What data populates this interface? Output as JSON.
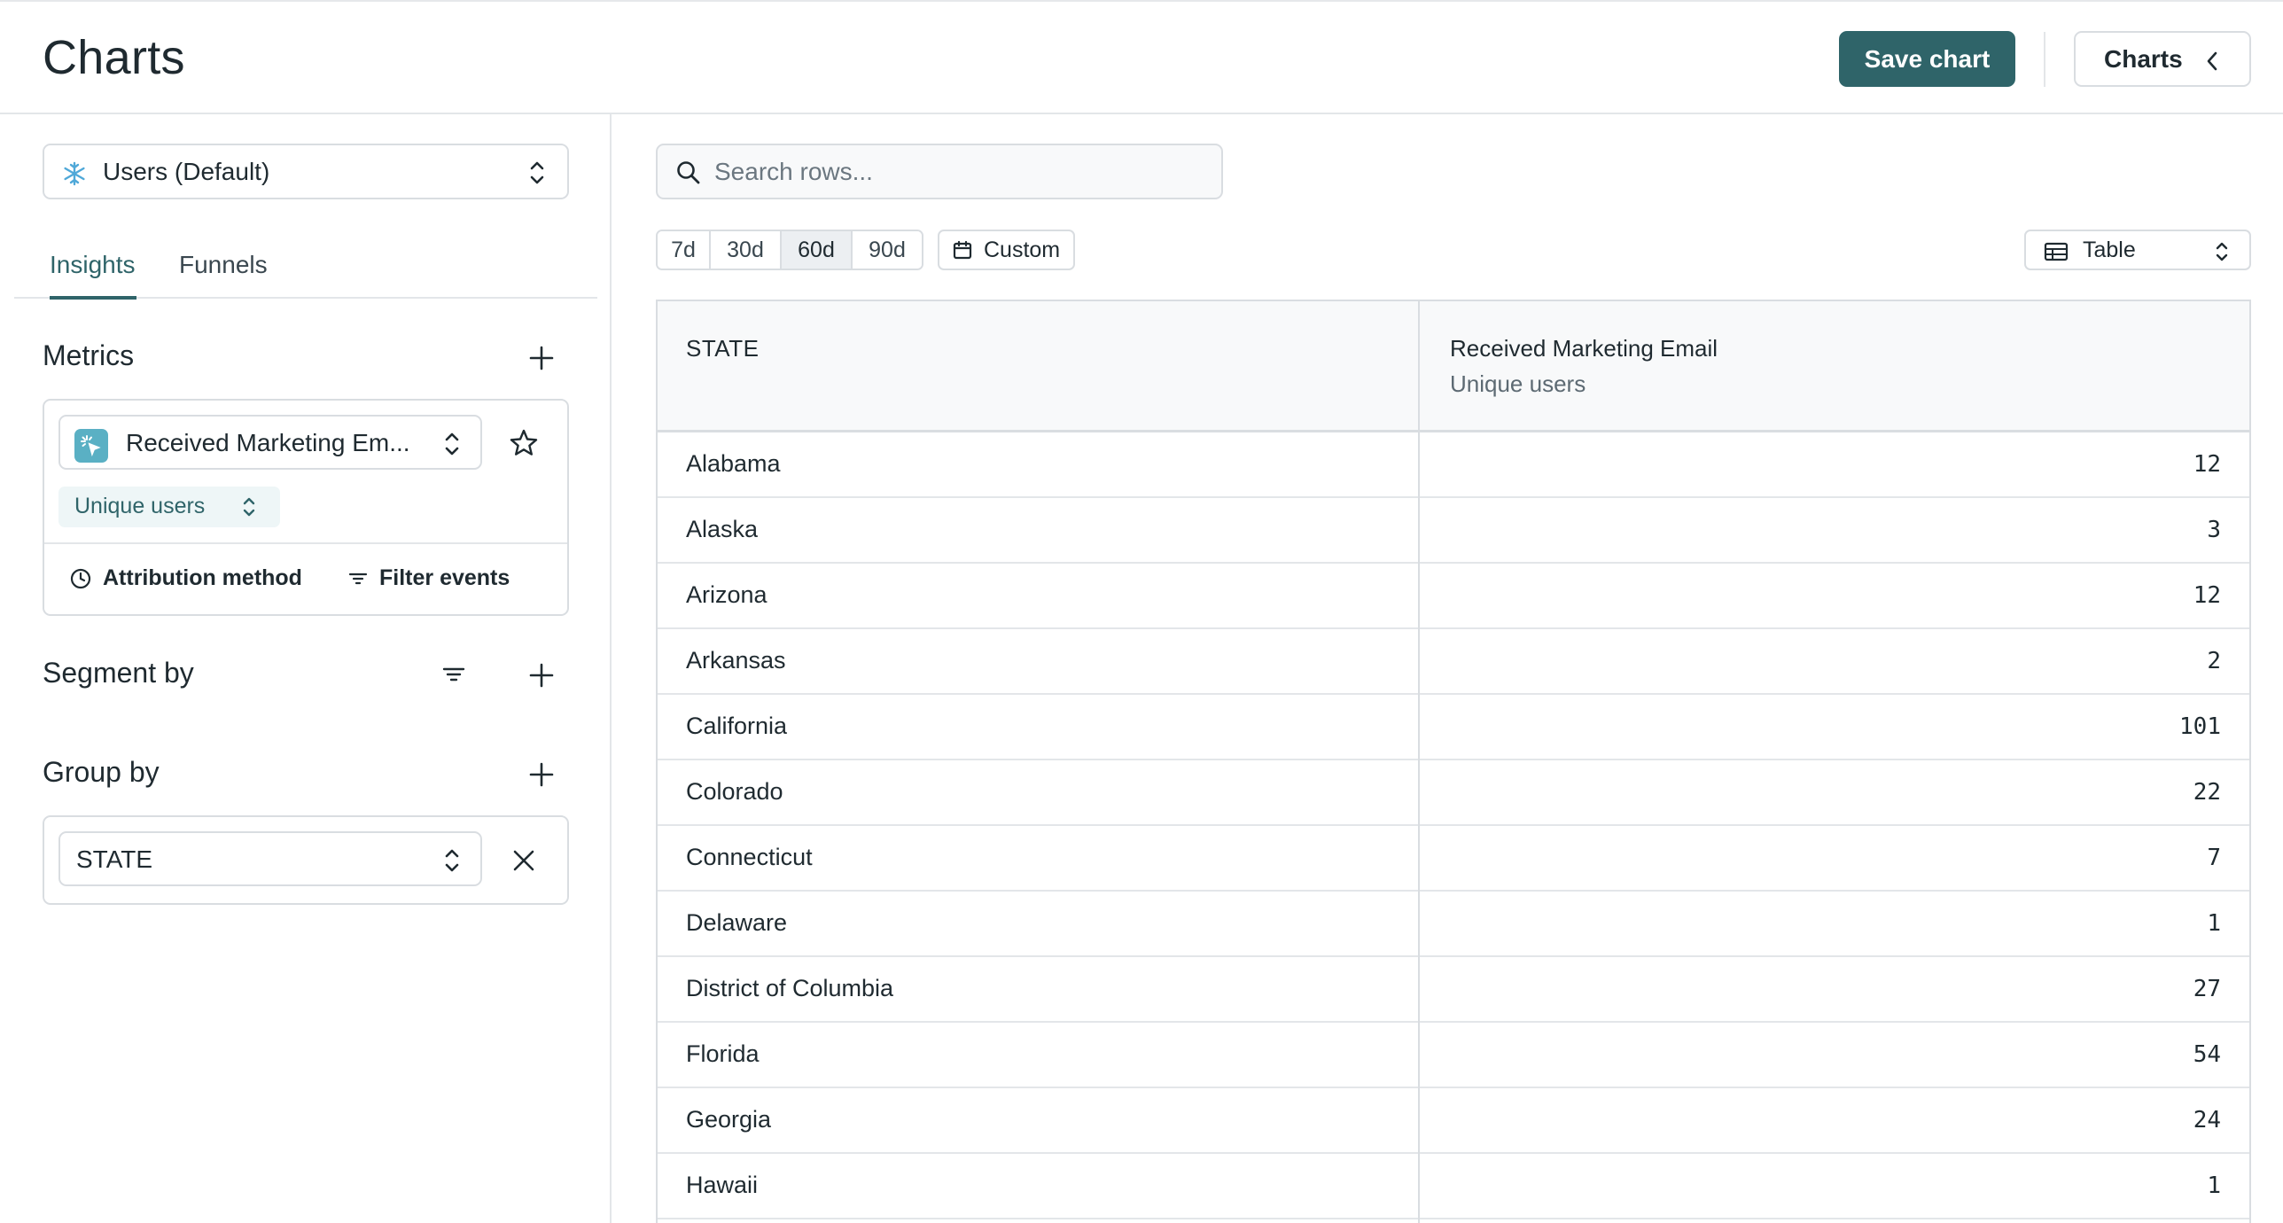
{
  "header": {
    "title": "Charts",
    "save_label": "Save chart",
    "charts_label": "Charts"
  },
  "sidebar": {
    "datasource": {
      "label": "Users (Default)",
      "icon": "snowflake-icon"
    },
    "tabs": [
      {
        "label": "Insights",
        "active": true
      },
      {
        "label": "Funnels",
        "active": false
      }
    ],
    "metrics": {
      "title": "Metrics",
      "event_label": "Received Marketing Em...",
      "aggregation_label": "Unique users",
      "attribution_label": "Attribution method",
      "filter_label": "Filter events"
    },
    "segment": {
      "title": "Segment by"
    },
    "group": {
      "title": "Group by",
      "value": "STATE"
    }
  },
  "main": {
    "search": {
      "placeholder": "Search rows..."
    },
    "ranges": [
      {
        "label": "7d",
        "active": false
      },
      {
        "label": "30d",
        "active": false
      },
      {
        "label": "60d",
        "active": true
      },
      {
        "label": "90d",
        "active": false
      }
    ],
    "custom_label": "Custom",
    "view_label": "Table",
    "table": {
      "col_state": "STATE",
      "col_metric": "Received Marketing Email",
      "col_metric_sub": "Unique users",
      "rows": [
        {
          "state": "Alabama",
          "value": "12"
        },
        {
          "state": "Alaska",
          "value": "3"
        },
        {
          "state": "Arizona",
          "value": "12"
        },
        {
          "state": "Arkansas",
          "value": "2"
        },
        {
          "state": "California",
          "value": "101"
        },
        {
          "state": "Colorado",
          "value": "22"
        },
        {
          "state": "Connecticut",
          "value": "7"
        },
        {
          "state": "Delaware",
          "value": "1"
        },
        {
          "state": "District of Columbia",
          "value": "27"
        },
        {
          "state": "Florida",
          "value": "54"
        },
        {
          "state": "Georgia",
          "value": "24"
        },
        {
          "state": "Hawaii",
          "value": "1"
        }
      ]
    }
  },
  "colors": {
    "accent": "#2f6469",
    "border": "#d9dde1",
    "event_icon": "#5ab0c4"
  }
}
